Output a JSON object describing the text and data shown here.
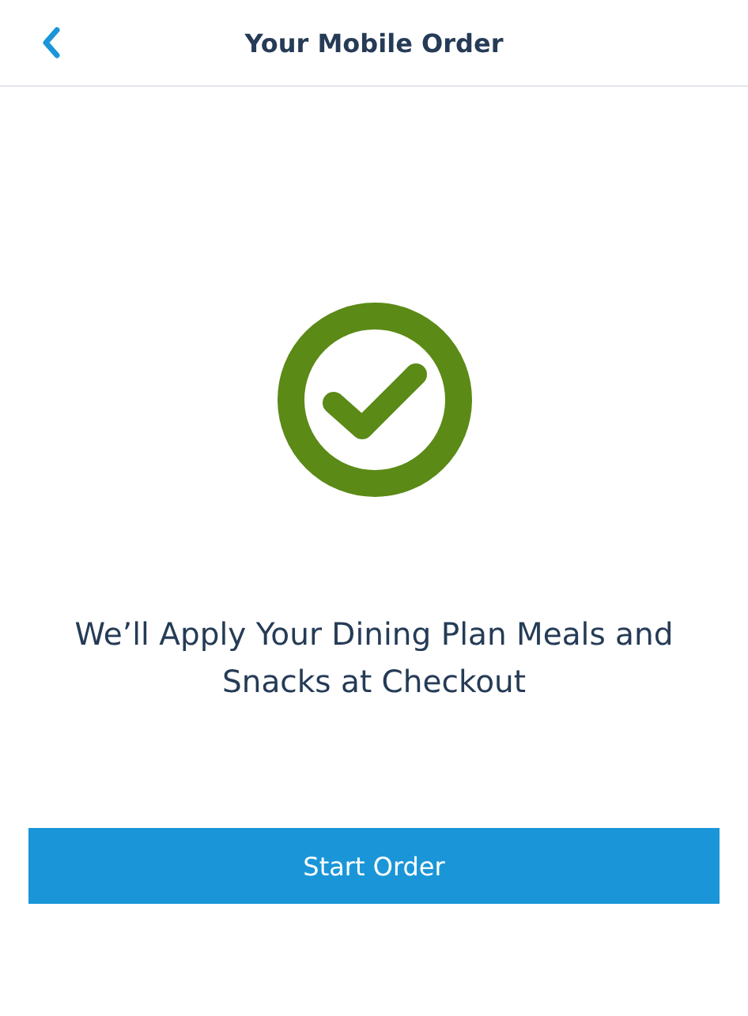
{
  "header": {
    "title": "Your Mobile Order"
  },
  "confirmation": {
    "message": "We’ll Apply Your Dining Plan Meals and Snacks at Checkout"
  },
  "buttons": [
    {
      "label": "Start Order",
      "kind": "primary"
    }
  ]
}
